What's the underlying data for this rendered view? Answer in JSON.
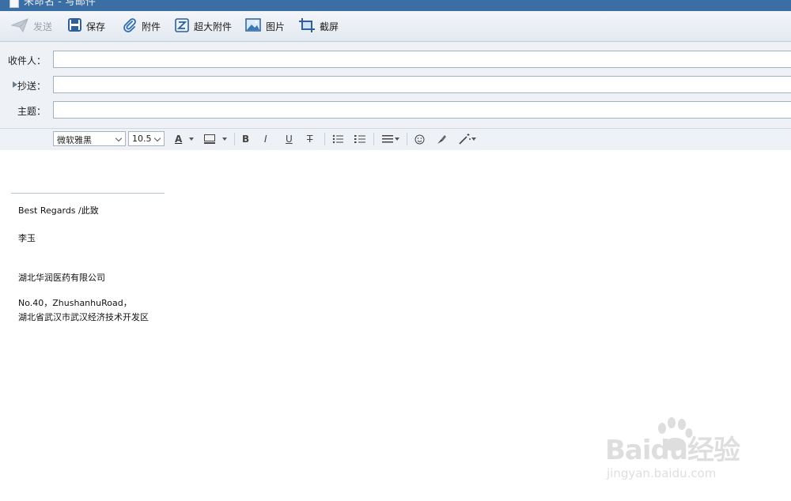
{
  "window": {
    "title": "未命名 - 写邮件"
  },
  "toolbar": {
    "send_label": "发送",
    "save_label": "保存",
    "attach_label": "附件",
    "large_attach_label": "超大附件",
    "image_label": "图片",
    "screenshot_label": "截屏"
  },
  "compose": {
    "to_label": "收件人：",
    "to_value": "",
    "cc_label": "抄送：",
    "cc_value": "",
    "subject_label": "主题：",
    "subject_value": ""
  },
  "format": {
    "font_family": "微软雅黑",
    "font_size": "10.5",
    "font_color_label": "A",
    "bold_label": "B",
    "italic_label": "I",
    "underline_label": "U",
    "strike_label": "T"
  },
  "signature": {
    "regards": "Best Regards /此致",
    "name": "李玉",
    "company": "湖北华润医药有限公司",
    "address_line1": "No.40，ZhushanhuRoad，",
    "address_line2": "湖北省武汉市武汉经济技术开发区"
  },
  "watermark": {
    "brand": "Baidu经验",
    "url": "jingyan.baidu.com"
  },
  "colors": {
    "titlebar": "#3a6ea5",
    "accent": "#2f6db5",
    "toolbar_bg": "#e3e9f1"
  }
}
